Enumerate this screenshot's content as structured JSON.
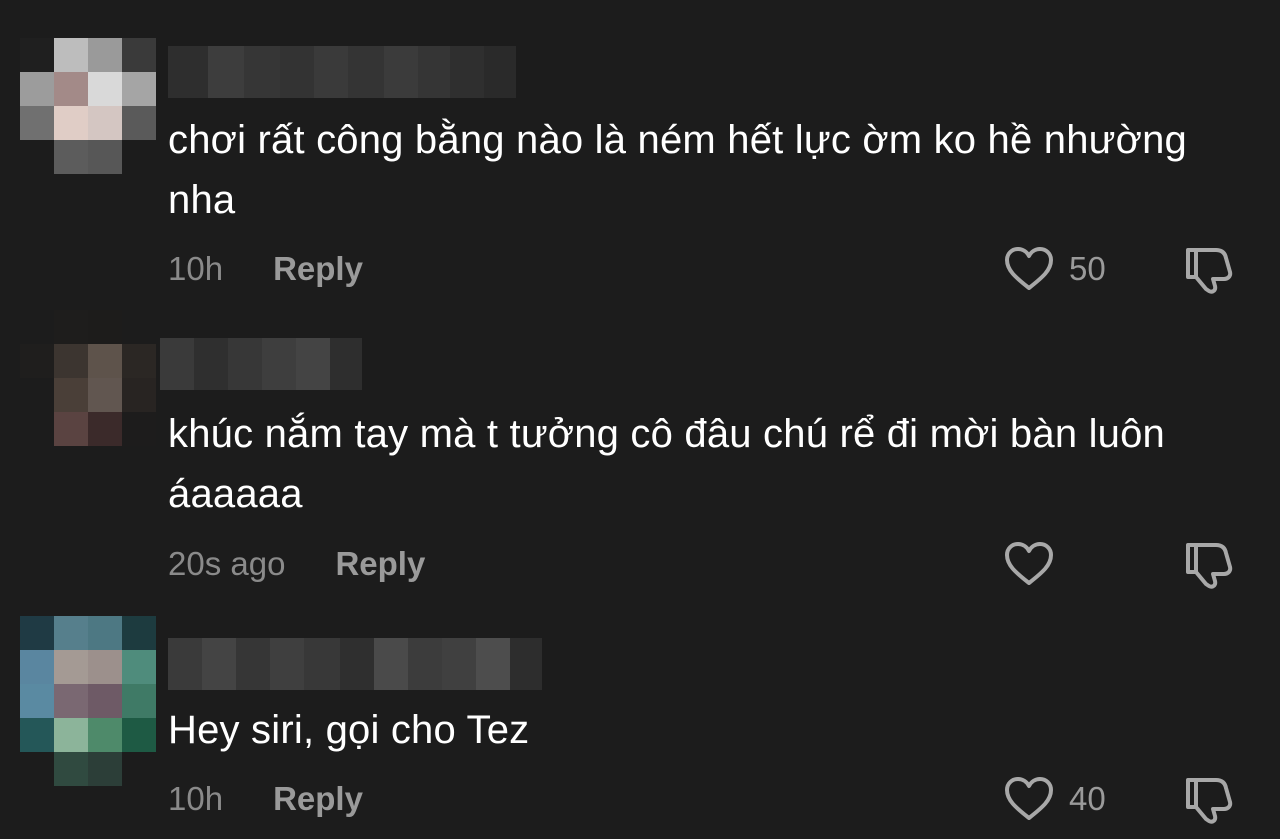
{
  "comments": [
    {
      "text": "chơi rất công bằng nào là ném hết lực ờm ko hề nhường nha",
      "time": "10h",
      "reply_label": "Reply",
      "likes": "50",
      "like_icon": "heart-outline-icon",
      "dislike_icon": "thumbs-down-icon"
    },
    {
      "text": "khúc nắm tay mà t tưởng cô đâu chú rể đi mời bàn luôn áaaaaa",
      "time": "20s ago",
      "reply_label": "Reply",
      "likes": "",
      "like_icon": "heart-outline-icon",
      "dislike_icon": "thumbs-down-icon"
    },
    {
      "text": "Hey siri, gọi cho Tez",
      "time": "10h",
      "reply_label": "Reply",
      "likes": "40",
      "like_icon": "heart-outline-icon",
      "dislike_icon": "thumbs-down-icon"
    }
  ],
  "colors": {
    "background": "#1c1c1c",
    "text": "#ffffff",
    "meta": "#8a8a8a",
    "icon": "#a8a8a8"
  }
}
